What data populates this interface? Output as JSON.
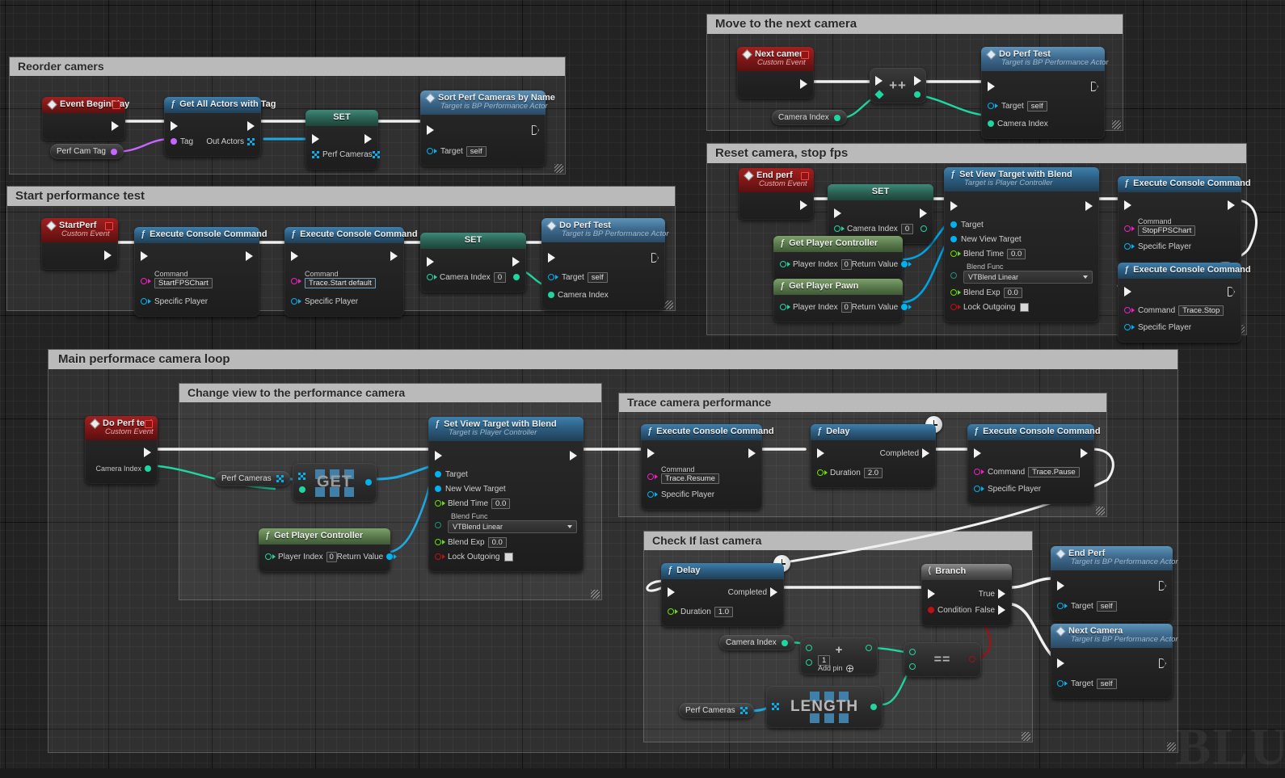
{
  "canvas": {
    "watermark": "BLU"
  },
  "comments": [
    {
      "id": "reorder",
      "title": "Reorder camers"
    },
    {
      "id": "startperf",
      "title": "Start performance test"
    },
    {
      "id": "nextcam",
      "title": "Move to the next camera"
    },
    {
      "id": "resetcam",
      "title": "Reset camera, stop fps"
    },
    {
      "id": "mainloop",
      "title": "Main performace camera loop"
    },
    {
      "id": "changeview",
      "title": "Change view to the performance camera"
    },
    {
      "id": "tracecam",
      "title": "Trace camera performance"
    },
    {
      "id": "checklast",
      "title": "Check If last camera"
    }
  ],
  "labels": {
    "custom_event": "Custom Event",
    "target_bp_perf": "Target is BP Performance Actor",
    "target_player_controller": "Target is Player Controller",
    "target": "Target",
    "self": "self",
    "command": "Command",
    "specific_player": "Specific Player",
    "tag": "Tag",
    "out_actors": "Out Actors",
    "perf_cameras": "Perf Cameras",
    "camera_index": "Camera Index",
    "set": "SET",
    "get": "GET",
    "length": "LENGTH",
    "player_index": "Player Index",
    "return_value": "Return Value",
    "new_view_target": "New View Target",
    "blend_time": "Blend Time",
    "blend_func": "Blend Func",
    "blend_exp": "Blend Exp",
    "lock_outgoing": "Lock Outgoing",
    "vtblend_linear": "VTBlend Linear",
    "completed": "Completed",
    "duration": "Duration",
    "condition": "Condition",
    "true": "True",
    "false": "False",
    "add_pin": "Add pin",
    "increment": "++",
    "equals": "==",
    "plus": "+",
    "zero": "0",
    "one_val": "1"
  },
  "nodes": {
    "event_begin_play": {
      "title": "Event BeginPlay"
    },
    "perf_cam_tag_var": {
      "title": "Perf Cam Tag"
    },
    "get_all_actors": {
      "title": "Get All Actors with Tag"
    },
    "set_perf_cameras": {
      "title": "SET",
      "pin": "Perf Cameras"
    },
    "sort_perf_cameras": {
      "title": "Sort Perf Cameras by Name",
      "sub": "Target is BP Performance Actor",
      "target": "self"
    },
    "start_perf_event": {
      "title": "StartPerf",
      "sub": "Custom Event"
    },
    "exec_startfps": {
      "title": "Execute Console Command",
      "command_label": "Command",
      "command": "StartFPSChart",
      "specific_player": "Specific Player"
    },
    "exec_tracestart": {
      "title": "Execute Console Command",
      "command_label": "Command",
      "command": "Trace.Start default",
      "specific_player": "Specific Player"
    },
    "set_cam_index_1": {
      "title": "SET",
      "pin": "Camera Index",
      "value": "0"
    },
    "do_perf_test_1": {
      "title": "Do Perf Test",
      "sub": "Target is BP Performance Actor",
      "target": "self",
      "pin": "Camera Index"
    },
    "next_camera_event": {
      "title": "Next camera",
      "sub": "Custom Event"
    },
    "increment_node": {
      "title": "++"
    },
    "camera_index_var1": {
      "title": "Camera Index"
    },
    "do_perf_test_2": {
      "title": "Do Perf Test",
      "sub": "Target is BP Performance Actor",
      "target": "self",
      "pin": "Camera Index"
    },
    "end_perf_event": {
      "title": "End perf",
      "sub": "Custom Event"
    },
    "set_cam_index_2": {
      "title": "SET",
      "pin": "Camera Index",
      "value": "0"
    },
    "get_player_ctrl_1": {
      "title": "Get Player Controller",
      "player_index": "0",
      "return_value": "Return Value"
    },
    "get_player_pawn": {
      "title": "Get Player Pawn",
      "player_index": "0",
      "return_value": "Return Value"
    },
    "set_view_target_1": {
      "title": "Set View Target with Blend",
      "sub": "Target is Player Controller",
      "blend_time": "0.0",
      "blend_func": "VTBlend Linear",
      "blend_exp": "0.0"
    },
    "exec_stopfps": {
      "title": "Execute Console Command",
      "command_label": "Command",
      "command": "StopFPSChart",
      "specific_player": "Specific Player"
    },
    "exec_tracestop": {
      "title": "Execute Console Command",
      "command_label": "Command",
      "command": "Trace.Stop",
      "specific_player": "Specific Player"
    },
    "do_perf_test_event": {
      "title": "Do Perf test",
      "sub": "Custom Event",
      "pin": "Camera Index"
    },
    "perf_cameras_var1": {
      "title": "Perf Cameras"
    },
    "get_array_node": {
      "title": "GET"
    },
    "get_player_ctrl_2": {
      "title": "Get Player Controller",
      "player_index": "0",
      "return_value": "Return Value"
    },
    "set_view_target_2": {
      "title": "Set View Target with Blend",
      "sub": "Target is Player Controller",
      "blend_time": "0.0",
      "blend_func": "VTBlend Linear",
      "blend_exp": "0.0"
    },
    "exec_traceresume": {
      "title": "Execute Console Command",
      "command_label": "Command",
      "command": "Trace.Resume",
      "specific_player": "Specific Player"
    },
    "delay_2": {
      "title": "Delay",
      "completed": "Completed",
      "duration_label": "Duration",
      "duration": "2.0"
    },
    "exec_tracepause": {
      "title": "Execute Console Command",
      "command_label": "Command",
      "command": "Trace.Pause",
      "specific_player": "Specific Player"
    },
    "delay_1": {
      "title": "Delay",
      "completed": "Completed",
      "duration_label": "Duration",
      "duration": "1.0"
    },
    "camera_index_var2": {
      "title": "Camera Index"
    },
    "add_node": {
      "title": "+",
      "operand": "1",
      "add_pin": "Add pin"
    },
    "perf_cameras_var2": {
      "title": "Perf Cameras"
    },
    "length_node": {
      "title": "LENGTH"
    },
    "equals_node": {
      "title": "=="
    },
    "branch_node": {
      "title": "Branch",
      "condition": "Condition",
      "true": "True",
      "false": "False"
    },
    "end_perf_call": {
      "title": "End Perf",
      "sub": "Target is BP Performance Actor",
      "target": "self"
    },
    "next_camera_call": {
      "title": "Next Camera",
      "sub": "Target is BP Performance Actor",
      "target": "self"
    }
  },
  "colors": {
    "exec": "#f0f0f0",
    "object": "#00b3f0",
    "string": "#f020c0",
    "integer": "#1fd6a0",
    "float": "#6ee000",
    "boolean": "#c01010",
    "name": "#c864ff",
    "comment_header": "#b9b9b9",
    "node_header_function": "#2c5f84",
    "node_header_event": "#7d1616",
    "node_header_pure": "#5a7b4c",
    "node_header_set": "#2a5e52"
  }
}
